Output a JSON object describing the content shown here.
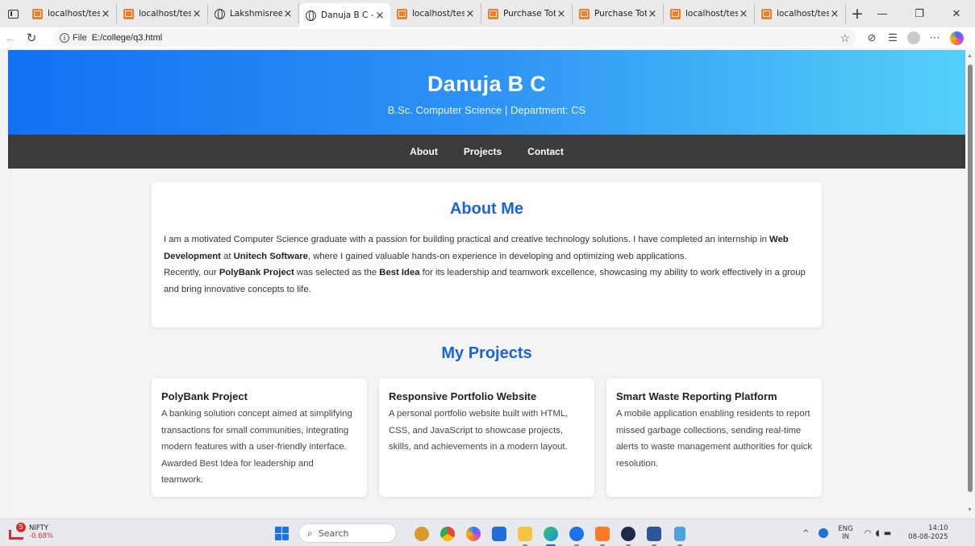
{
  "browser": {
    "tabs": [
      {
        "title": "localhost/testp",
        "icon": "xampp-icon",
        "active": false
      },
      {
        "title": "localhost/testp",
        "icon": "xampp-icon",
        "active": false
      },
      {
        "title": "Lakshmisree T",
        "icon": "globe-icon",
        "active": false
      },
      {
        "title": "Danuja B C - Po",
        "icon": "globe-icon",
        "active": true
      },
      {
        "title": "localhost/testp",
        "icon": "xampp-icon",
        "active": false
      },
      {
        "title": "Purchase Total",
        "icon": "xampp-icon",
        "active": false
      },
      {
        "title": "Purchase Total",
        "icon": "xampp-icon",
        "active": false
      },
      {
        "title": "localhost/testp",
        "icon": "xampp-icon",
        "active": false
      },
      {
        "title": "localhost/testp",
        "icon": "xampp-icon",
        "active": false
      }
    ],
    "new_tab_symbol": "+",
    "address": {
      "scheme_label": "File",
      "url": "E:/college/q3.html"
    }
  },
  "page": {
    "header": {
      "name": "Danuja B C",
      "subtitle": "B.Sc. Computer Science | Department: CS"
    },
    "nav": [
      "About",
      "Projects",
      "Contact"
    ],
    "about": {
      "title": "About Me",
      "p1_a": "I am a motivated Computer Science graduate with a passion for building practical and creative technology solutions. I have completed an internship in ",
      "p1_b": "Web Development",
      "p1_c": " at ",
      "p1_d": "Unitech Software",
      "p1_e": ", where I gained valuable hands-on experience in developing and optimizing web applications.",
      "p2_a": "Recently, our ",
      "p2_b": "PolyBank Project",
      "p2_c": " was selected as the ",
      "p2_d": "Best Idea",
      "p2_e": " for its leadership and teamwork excellence, showcasing my ability to work effectively in a group and bring innovative concepts to life."
    },
    "projects": {
      "title": "My Projects",
      "items": [
        {
          "name": "PolyBank Project",
          "desc": "A banking solution concept aimed at simplifying transactions for small communities, integrating modern features with a user-friendly interface. Awarded Best Idea for leadership and teamwork."
        },
        {
          "name": "Responsive Portfolio Website",
          "desc": "A personal portfolio website built with HTML, CSS, and JavaScript to showcase projects, skills, and achievements in a modern layout."
        },
        {
          "name": "Smart Waste Reporting Platform",
          "desc": "A mobile application enabling residents to report missed garbage collections, sending real-time alerts to waste management authorities for quick resolution."
        }
      ]
    },
    "colors": {
      "accent": "#1a63d9",
      "nav_bg": "#3b3b3b",
      "hero_start": "#1270f3",
      "hero_end": "#56cff8"
    }
  },
  "taskbar": {
    "widget": {
      "badge": "5",
      "name": "NIFTY",
      "change": "-0.68%"
    },
    "search_placeholder": "Search",
    "tray": {
      "lang_top": "ENG",
      "lang_bottom": "IN",
      "time": "14:10",
      "date": "08-08-2025"
    }
  }
}
